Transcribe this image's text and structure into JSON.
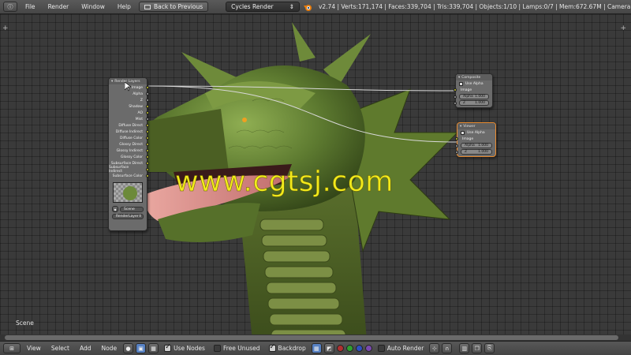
{
  "topbar": {
    "menus": [
      "File",
      "Render",
      "Window",
      "Help"
    ],
    "back_button": "Back to Previous",
    "render_engine": "Cycles Render",
    "stats": "v2.74 | Verts:171,174 | Faces:339,704 | Tris:339,704 | Objects:1/10 | Lamps:0/7 | Mem:672.67M | Camera"
  },
  "render_layers_node": {
    "title": "Render Layers",
    "outputs": [
      "Image",
      "Alpha",
      "Z",
      "Shadow",
      "AO",
      "Mist",
      "Diffuse Direct",
      "Diffuse Indirect",
      "Diffuse Color",
      "Glossy Direct",
      "Glossy Indirect",
      "Glossy Color",
      "Subsurface Direct",
      "Subsurface Indirect",
      "Subsurface Color"
    ],
    "scene": "Scene",
    "layer": "RenderLayer"
  },
  "composite_node": {
    "title": "Composite",
    "use_alpha_label": "Use Alpha",
    "inputs": [
      "Image"
    ],
    "alpha_label": "Alpha",
    "alpha_value": "1.000",
    "z_label": "Z",
    "z_value": "1.000"
  },
  "viewer_node": {
    "title": "Viewer",
    "use_alpha_label": "Use Alpha",
    "inputs": [
      "Image"
    ],
    "alpha_label": "Alpha",
    "alpha_value": "1.000",
    "z_label": "Z",
    "z_value": "1.000"
  },
  "scene_label": "Scene",
  "watermark": "www.cgtsj.com",
  "bottombar": {
    "menus": [
      "View",
      "Select",
      "Add",
      "Node"
    ],
    "use_nodes": "Use Nodes",
    "free_unused": "Free Unused",
    "backdrop": "Backdrop",
    "auto_render": "Auto Render"
  },
  "colors": {
    "socket_yellow": "#c7c729",
    "link": "#d8d8d8",
    "viewer_highlight": "#e88a2e",
    "watermark": "#f2ea1c"
  }
}
